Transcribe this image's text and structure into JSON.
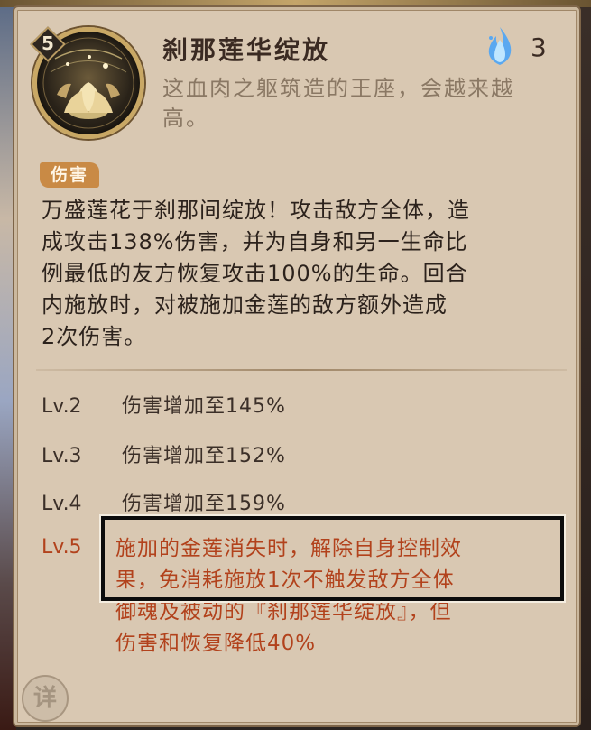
{
  "skill": {
    "level": "5",
    "title": "刹那莲华绽放",
    "cost": "3",
    "cost_icon": "blue-flame-icon",
    "flavor": "这血肉之躯筑造的王座，会越来越高。",
    "tag": "伤害",
    "description_lines": [
      "万盛莲花于刹那间绽放！攻击敌方全体，造",
      "成攻击138%伤害，并为自身和另一生命比",
      "例最低的友方恢复攻击100%的生命。回合",
      "内施放时，对被施加金莲的敌方额外造成",
      "2次伤害。"
    ]
  },
  "levels": [
    {
      "lv": "Lv.2",
      "text": "伤害增加至145%"
    },
    {
      "lv": "Lv.3",
      "text": "伤害增加至152%"
    },
    {
      "lv": "Lv.4",
      "text": "伤害增加至159%"
    }
  ],
  "lv5": {
    "lv": "Lv.5",
    "lines": [
      "施加的金莲消失时，解除自身控制效",
      "果，免消耗施放1次不触发敌方全体",
      "御魂及被动的『刹那莲华绽放』，但",
      "伤害和恢复降低40%"
    ]
  },
  "detail_button": "详",
  "colors": {
    "card_bg": "#d9c8b2",
    "tag_bg": "#c98a45",
    "lv5_text": "#b2421c",
    "text": "#2c221c"
  }
}
